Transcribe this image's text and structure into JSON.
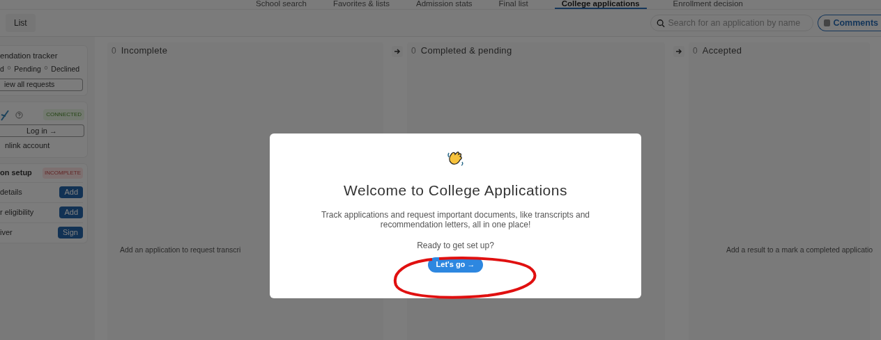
{
  "tabs": [
    {
      "label": "School search",
      "selected": false
    },
    {
      "label": "Favorites & lists",
      "selected": false
    },
    {
      "label": "Admission stats",
      "selected": false
    },
    {
      "label": "Final list",
      "selected": false
    },
    {
      "label": "College applications",
      "selected": true
    },
    {
      "label": "Enrollment decision",
      "selected": false
    }
  ],
  "toolbar": {
    "view_button": "List",
    "search": {
      "placeholder": "Search for an application by name"
    },
    "comments_button": "Comments"
  },
  "sidebar": {
    "tracker": {
      "title": "endation tracker",
      "statuses": [
        {
          "label": "d"
        },
        {
          "count": "0",
          "label": "Pending"
        },
        {
          "count": "0",
          "label": "Declined"
        }
      ],
      "button": "iew all requests"
    },
    "account": {
      "badge": "CONNECTED",
      "login_button": "Log in →",
      "unlink": "nlink account"
    },
    "setup": {
      "title": "on setup",
      "badge": "INCOMPLETE",
      "rows": [
        {
          "label": "details",
          "action": "Add"
        },
        {
          "label": "r eligibility",
          "action": "Add"
        },
        {
          "label": "iver",
          "action": "Sign"
        }
      ]
    }
  },
  "columns": [
    {
      "count": "0",
      "title": "Incomplete",
      "empty_text": "Add an application to request transcri",
      "arrow": false
    },
    {
      "count": "0",
      "title": "Completed & pending",
      "arrow": true
    },
    {
      "count": "0",
      "title": "Accepted",
      "empty_text": "Add a result to a mark a completed applicatio",
      "arrow": true
    }
  ],
  "modal": {
    "title": "Welcome to College Applications",
    "body": "Track applications and request important documents, like transcripts and recommendation letters, all in one place!",
    "prompt": "Ready to get set up?",
    "button": "Let's go →"
  }
}
